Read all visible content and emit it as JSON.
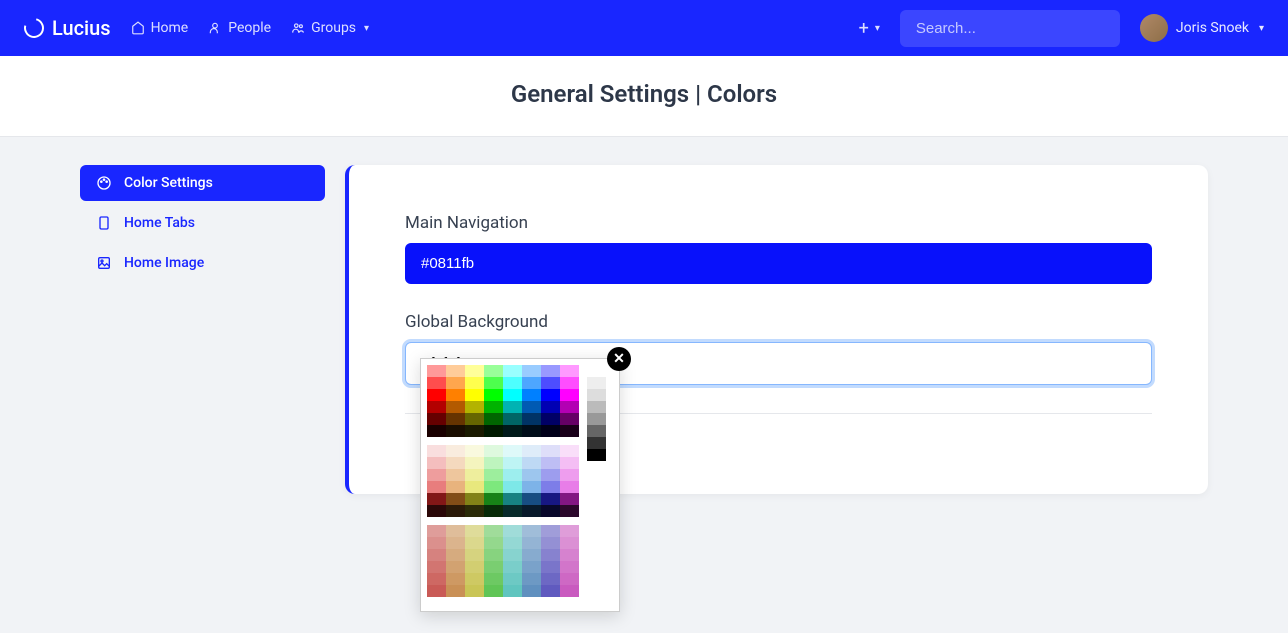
{
  "brand": "Lucius",
  "nav": {
    "home": "Home",
    "people": "People",
    "groups": "Groups"
  },
  "search": {
    "placeholder": "Search..."
  },
  "user": {
    "name": "Joris Snoek"
  },
  "page": {
    "title": "General Settings | Colors"
  },
  "sidebar": {
    "items": [
      {
        "label": "Color Settings"
      },
      {
        "label": "Home Tabs"
      },
      {
        "label": "Home Image"
      }
    ]
  },
  "form": {
    "main_nav": {
      "label": "Main Navigation",
      "value": "#0811fb"
    },
    "global_bg": {
      "label": "Global Background",
      "value": "#f1f3f6"
    }
  },
  "colors": {
    "accent": "#1926ff",
    "bg": "#f1f3f6"
  },
  "picker": {
    "hues": [
      "#ff0000",
      "#ff8000",
      "#ffff00",
      "#00ff00",
      "#00ffff",
      "#0080ff",
      "#0000ff",
      "#ff00ff"
    ],
    "grays": [
      "#ffffff",
      "#eeeeee",
      "#dddddd",
      "#bbbbbb",
      "#999999",
      "#666666",
      "#333333",
      "#000000"
    ]
  }
}
